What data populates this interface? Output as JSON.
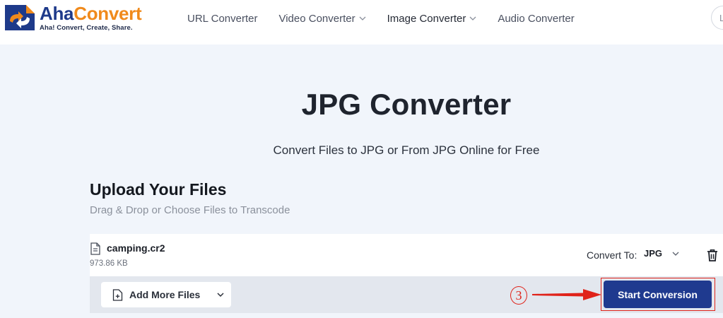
{
  "brand": {
    "name_part1": "Aha",
    "name_part2": "Convert",
    "tagline": "Aha! Convert, Create, Share.",
    "primary_color": "#1e3a8a",
    "accent_color": "#f08a1c"
  },
  "nav": {
    "items": [
      {
        "label": "URL Converter",
        "has_dropdown": false
      },
      {
        "label": "Video Converter",
        "has_dropdown": true
      },
      {
        "label": "Image Converter",
        "has_dropdown": true
      },
      {
        "label": "Audio Converter",
        "has_dropdown": false
      }
    ],
    "language_button": "L"
  },
  "hero": {
    "title": "JPG Converter",
    "subtitle": "Convert Files to JPG or From JPG Online for Free"
  },
  "upload": {
    "title": "Upload Your Files",
    "subtitle": "Drag & Drop or Choose Files to Transcode"
  },
  "file": {
    "name": "camping.cr2",
    "size": "973.86 KB",
    "icon": "document-icon",
    "convert_to_label": "Convert To:",
    "convert_to_value": "JPG"
  },
  "actions": {
    "add_more_label": "Add More Files",
    "start_label": "Start Conversion",
    "step_number": "3",
    "annotation_color": "#e0231a",
    "button_color": "#1f3a8f"
  }
}
